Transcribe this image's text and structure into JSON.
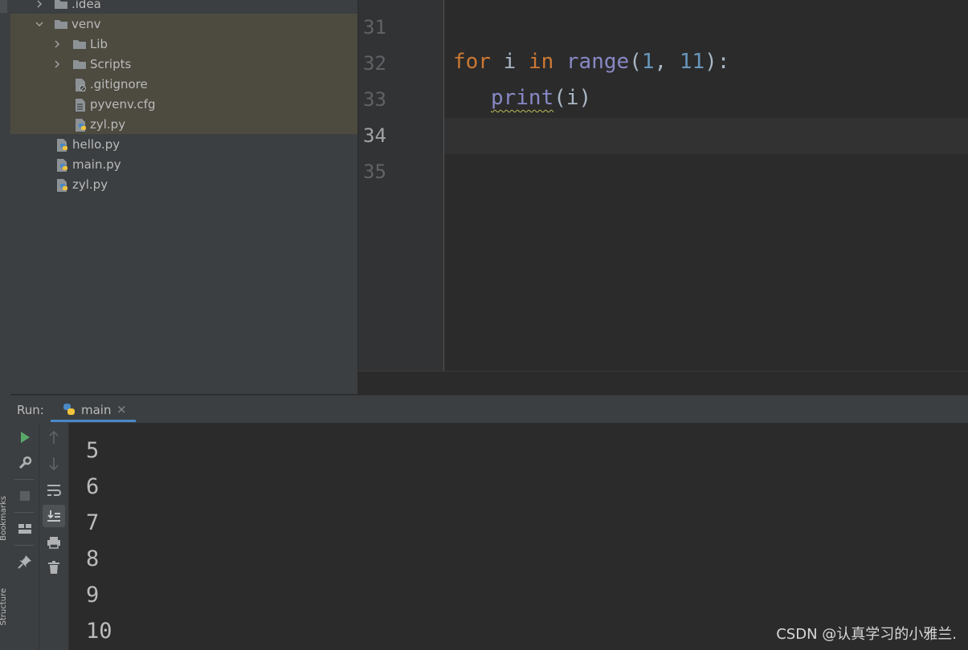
{
  "side_strip": {
    "bookmarks_label": "Bookmarks",
    "structure_label": "Structure"
  },
  "project_tree": [
    {
      "label": ".idea",
      "type": "folder",
      "expanded": false,
      "indent": 1,
      "selected": false
    },
    {
      "label": "venv",
      "type": "folder",
      "expanded": true,
      "indent": 1,
      "selected": true
    },
    {
      "label": "Lib",
      "type": "folder",
      "expanded": false,
      "indent": 2,
      "selected": true
    },
    {
      "label": "Scripts",
      "type": "folder",
      "expanded": false,
      "indent": 2,
      "selected": true
    },
    {
      "label": ".gitignore",
      "type": "ignore-file",
      "indent": 2,
      "selected": true
    },
    {
      "label": "pyvenv.cfg",
      "type": "config-file",
      "indent": 2,
      "selected": true
    },
    {
      "label": "zyl.py",
      "type": "python-file",
      "indent": 2,
      "selected": true
    },
    {
      "label": "hello.py",
      "type": "python-file",
      "indent": 1,
      "selected": false
    },
    {
      "label": "main.py",
      "type": "python-file",
      "indent": 1,
      "selected": false
    },
    {
      "label": "zyl.py",
      "type": "python-file",
      "indent": 1,
      "selected": false
    }
  ],
  "editor": {
    "line_numbers": [
      "31",
      "32",
      "33",
      "34",
      "35"
    ],
    "current_line": "34",
    "code": {
      "line32": {
        "kw_for": "for",
        "var": " i ",
        "kw_in": "in",
        "space": " ",
        "fn_range": "range",
        "open": "(",
        "arg1": "1",
        "comma": ", ",
        "arg2": "11",
        "close": "):"
      },
      "line33": {
        "indent": "   ",
        "fn_print": "print",
        "args": "(i)"
      }
    }
  },
  "run_panel": {
    "label": "Run:",
    "tab_label": "main",
    "tab_close": "×",
    "toolbar_left": [
      "rerun-icon",
      "wrench-icon",
      "stop-icon",
      "layout-icon",
      "pin-icon"
    ],
    "toolbar_right": [
      "up-arrow-icon",
      "down-arrow-icon",
      "soft-wrap-icon",
      "scroll-to-end-icon",
      "print-icon",
      "trash-icon"
    ],
    "output_lines": [
      "5",
      "6",
      "7",
      "8",
      "9",
      "10"
    ]
  },
  "watermark": "CSDN @认真学习的小雅兰.",
  "colors": {
    "keyword": "#cc7832",
    "builtin": "#8888c6",
    "number": "#6897bb",
    "text": "#a9b7c6",
    "run_green": "#59a869",
    "selection": "#4d4a40",
    "tab_underline": "#4a88c7"
  }
}
